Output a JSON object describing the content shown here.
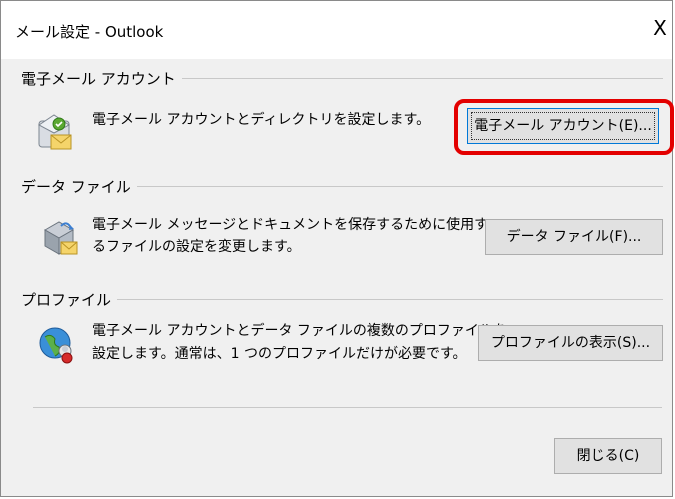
{
  "window": {
    "title": "メール設定 - Outlook",
    "close_glyph": "X"
  },
  "email_section": {
    "heading": "電子メール アカウント",
    "description": "電子メール アカウントとディレクトリを設定します。",
    "button_label": "電子メール アカウント(E)...",
    "icon": "email-accounts-icon"
  },
  "data_section": {
    "heading": "データ ファイル",
    "description_line1": "電子メール メッセージとドキュメントを保存するために使用す",
    "description_line2": "るファイルの設定を変更します。",
    "button_label": "データ ファイル(F)...",
    "icon": "data-files-icon"
  },
  "profile_section": {
    "heading": "プロファイル",
    "description_line1": "電子メール アカウントとデータ ファイルの複数のプロファイルを",
    "description_line2": "設定します。通常は、1 つのプロファイルだけが必要です。",
    "button_label": "プロファイルの表示(S)...",
    "icon": "profiles-icon"
  },
  "footer": {
    "close_button_label": "閉じる(C)"
  },
  "colors": {
    "highlight": "#e30000",
    "dialog_bg": "#f0f0f0",
    "button_bg": "#e1e1e1"
  }
}
